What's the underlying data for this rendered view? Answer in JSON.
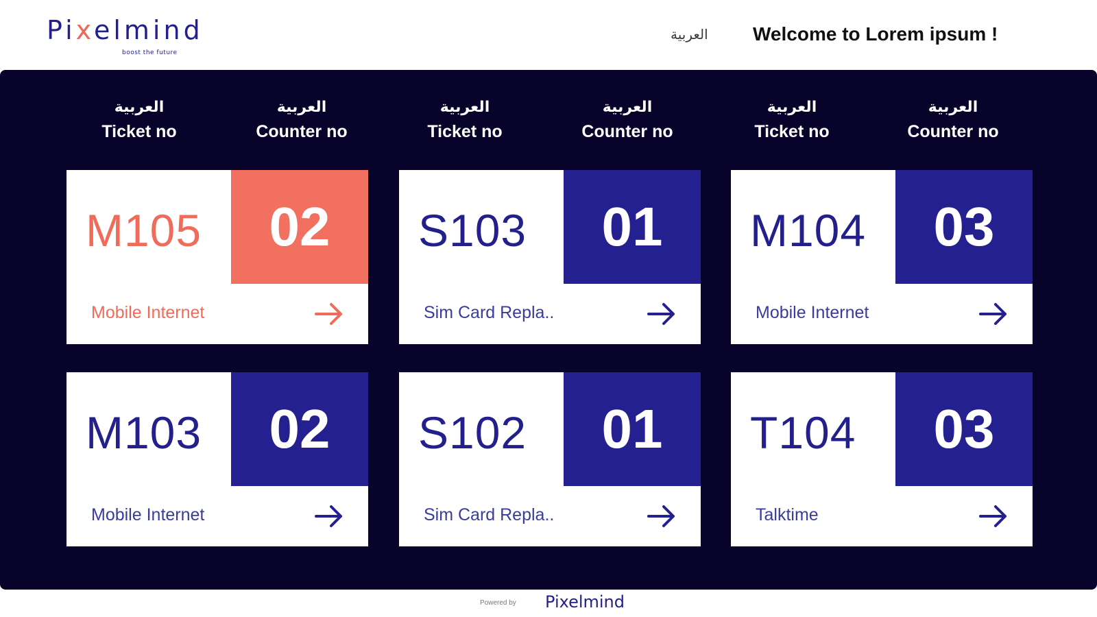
{
  "header": {
    "logo_text_pre": "Pi",
    "logo_text_x": "x",
    "logo_text_post": "elmind",
    "logo_tagline": "boost the future",
    "language_link": "العربية",
    "welcome": "Welcome to Lorem ipsum !"
  },
  "columns": [
    {
      "ar": "العربية",
      "en": "Ticket no"
    },
    {
      "ar": "العربية",
      "en": "Counter no"
    },
    {
      "ar": "العربية",
      "en": "Ticket no"
    },
    {
      "ar": "العربية",
      "en": "Counter no"
    },
    {
      "ar": "العربية",
      "en": "Ticket no"
    },
    {
      "ar": "العربية",
      "en": "Counter no"
    }
  ],
  "cards": [
    {
      "ticket": "M105",
      "counter": "02",
      "service": "Mobile Internet",
      "active": true
    },
    {
      "ticket": "S103",
      "counter": "01",
      "service": "Sim Card Repla..",
      "active": false
    },
    {
      "ticket": "M104",
      "counter": "03",
      "service": "Mobile Internet",
      "active": false
    },
    {
      "ticket": "M103",
      "counter": "02",
      "service": "Mobile Internet",
      "active": false
    },
    {
      "ticket": "S102",
      "counter": "01",
      "service": "Sim Card Repla..",
      "active": false
    },
    {
      "ticket": "T104",
      "counter": "03",
      "service": "Talktime",
      "active": false
    }
  ],
  "footer": {
    "powered_by": "Powered by",
    "logo_text": "Pixelmind"
  },
  "colors": {
    "navy_bg": "#07032a",
    "accent_blue": "#24208f",
    "highlight_coral": "#f1705f"
  },
  "icons": {
    "card_arrow": "arrow-right-icon"
  }
}
